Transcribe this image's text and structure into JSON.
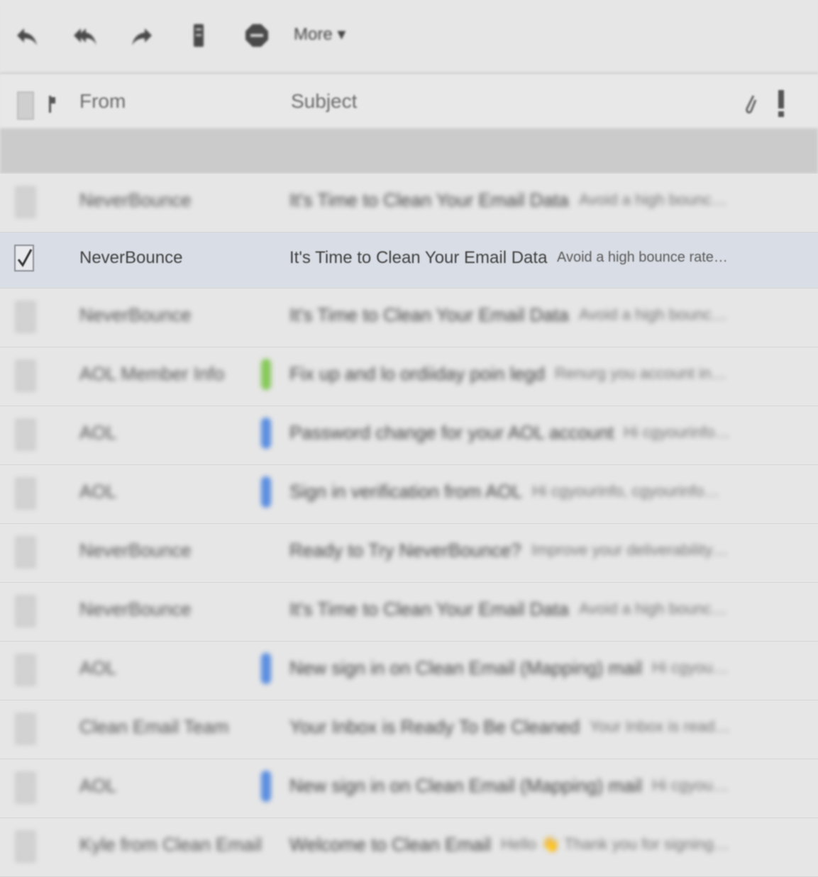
{
  "toolbar": {
    "buttons": [
      {
        "name": "reply-icon"
      },
      {
        "name": "reply-all-icon"
      },
      {
        "name": "forward-icon"
      },
      {
        "name": "archive-icon"
      },
      {
        "name": "spam-icon"
      }
    ],
    "more_label": "More ▾"
  },
  "header": {
    "from_label": "From",
    "subject_label": "Subject"
  },
  "emails": [
    {
      "sender": "NeverBounce",
      "subject": "It's Time to Clean Your Email Data",
      "snippet": "Avoid a high bounce rate and reach ..."
    },
    {
      "sender": "NeverBounce",
      "subject": "It's Time to Clean Your Email Data",
      "snippet": "Avoid a high bounce rate and reach ...",
      "selected": true
    },
    {
      "sender": "NeverBounce",
      "subject": "It's Time to Clean Your Email Data",
      "snippet": "Avoid a high bounce rate and reach ..."
    },
    {
      "sender": "AOL Member Info",
      "subject": "Fix up and lo ordiiday poin legd",
      "snippet": "Renurg you account informatio fo...",
      "tag": "green"
    },
    {
      "sender": "AOL",
      "subject": "Password change for your AOL account",
      "snippet": "Hi cgyourinfo, The passwo...",
      "tag": "blue"
    },
    {
      "sender": "AOL",
      "subject": "Sign in verification from AOL",
      "snippet": "Hi cgyourinfo, cgyourinfo@aol.co...",
      "tag": "blue"
    },
    {
      "sender": "NeverBounce",
      "subject": "Ready to Try NeverBounce?",
      "snippet": "Improve your deliverability and stop probl...",
      "tag": ""
    },
    {
      "sender": "NeverBounce",
      "subject": "It's Time to Clean Your Email Data",
      "snippet": "Avoid a high bounce rate and reach ..."
    },
    {
      "sender": "AOL",
      "subject": "New sign in on Clean Email (Mapping) mail",
      "snippet": "Hi cgyourinfo, Your AOL...",
      "tag": "blue"
    },
    {
      "sender": "Clean Email Team",
      "subject": "Your Inbox is Ready To Be Cleaned",
      "snippet": "Your Inbox is ready to be cleaned...",
      "tag": ""
    },
    {
      "sender": "AOL",
      "subject": "New sign in on Clean Email (Mapping) mail",
      "snippet": "Hi cgyourinfo, Your AOL...",
      "tag": "blue"
    },
    {
      "sender": "Kyle from Clean Email",
      "subject": "Welcome to Clean Email",
      "snippet": "Hello 👋 Thank you for signing up for Clean E...",
      "tag": ""
    }
  ],
  "colors": {
    "tag_green": "#86c85a",
    "tag_blue": "#5b8ee0",
    "selected_row": "#d9dde5"
  }
}
